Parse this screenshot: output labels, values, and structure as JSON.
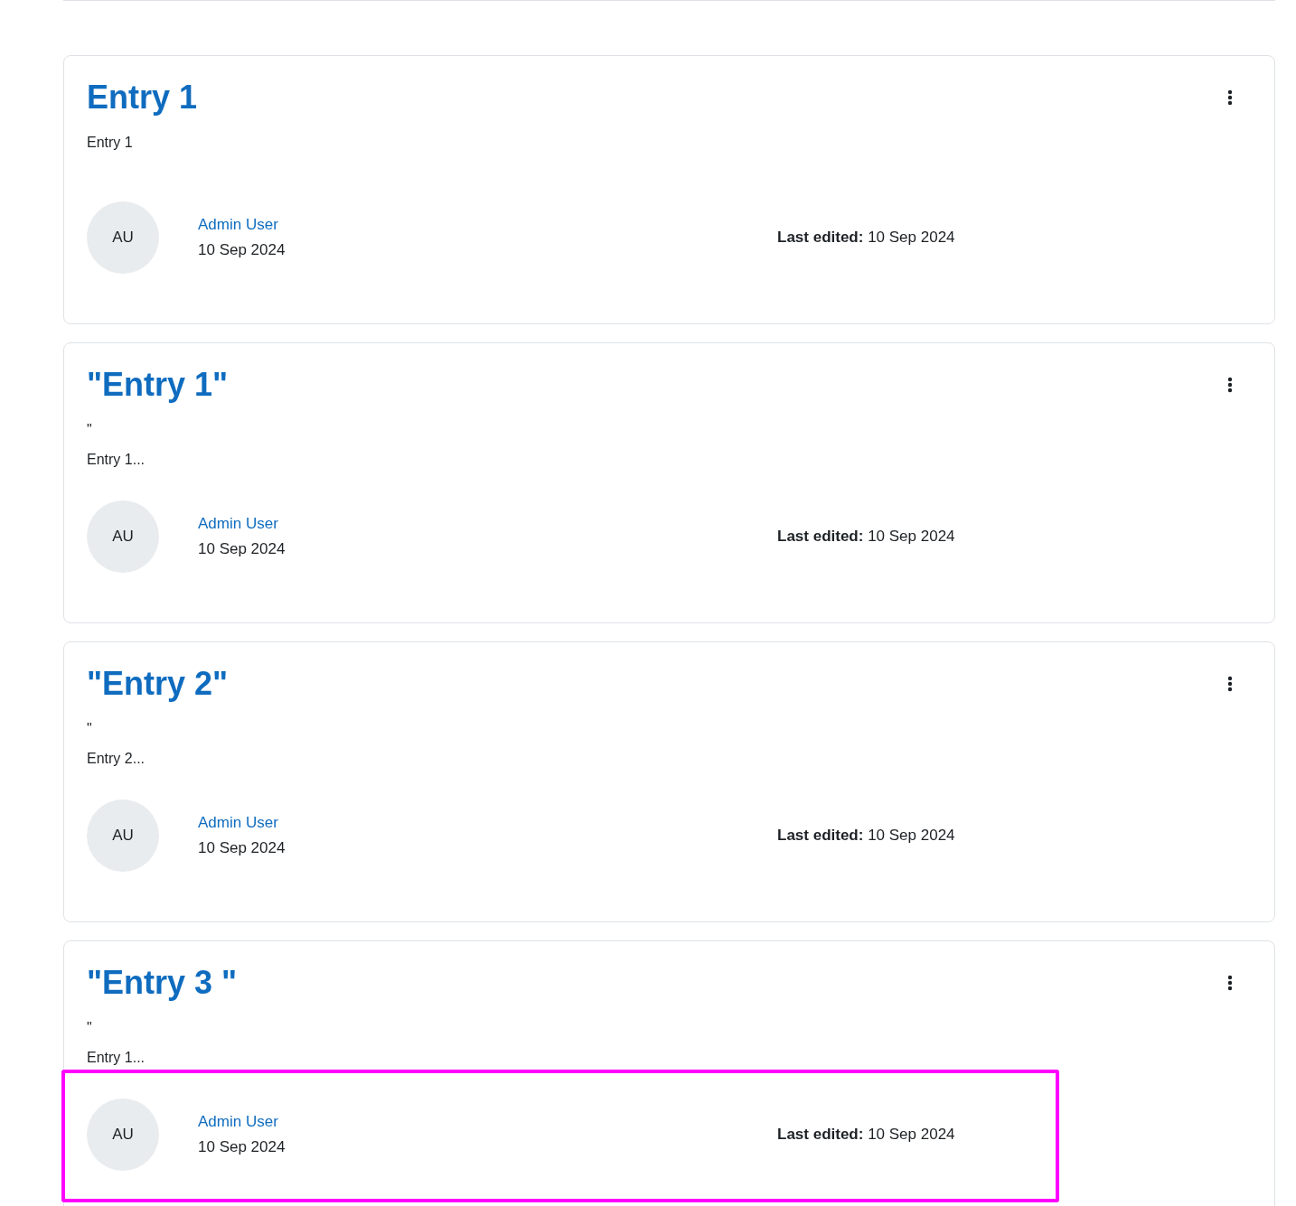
{
  "entries": [
    {
      "title": "Entry 1",
      "body": [
        "Entry 1"
      ],
      "avatar": "AU",
      "author": "Admin User",
      "date": "10 Sep 2024",
      "last_edited_label": "Last edited:",
      "last_edited": "10 Sep 2024",
      "highlighted": false
    },
    {
      "title": "\"Entry 1\"",
      "body": [
        "\"",
        "Entry 1..."
      ],
      "avatar": "AU",
      "author": "Admin User",
      "date": "10 Sep 2024",
      "last_edited_label": "Last edited:",
      "last_edited": "10 Sep 2024",
      "highlighted": false
    },
    {
      "title": "\"Entry 2\"",
      "body": [
        "\"",
        "Entry 2..."
      ],
      "avatar": "AU",
      "author": "Admin User",
      "date": "10 Sep 2024",
      "last_edited_label": "Last edited:",
      "last_edited": "10 Sep 2024",
      "highlighted": false
    },
    {
      "title": "\"Entry 3 \"",
      "body": [
        "\"",
        "Entry 1..."
      ],
      "avatar": "AU",
      "author": "Admin User",
      "date": "10 Sep 2024",
      "last_edited_label": "Last edited:",
      "last_edited": "10 Sep 2024",
      "highlighted": true
    }
  ]
}
